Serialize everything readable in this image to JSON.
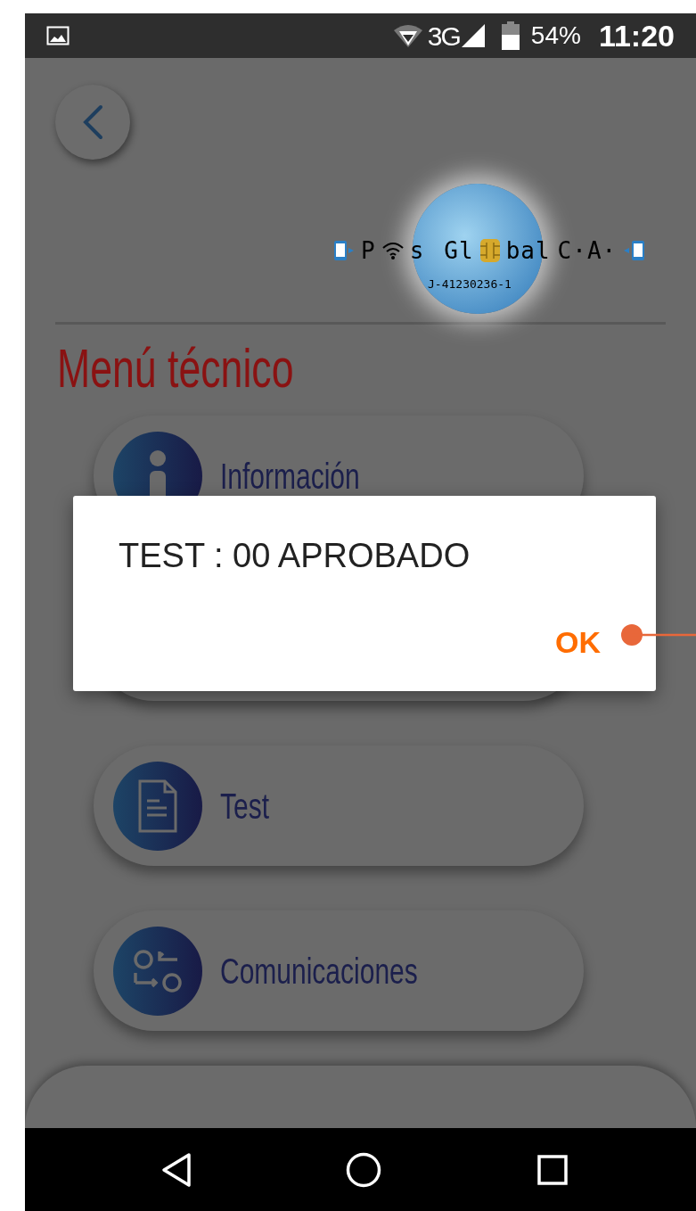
{
  "status_bar": {
    "network": "3G",
    "battery": "54%",
    "time": "11:20"
  },
  "logo": {
    "parts": [
      {
        "kind": "text",
        "text": "P"
      },
      {
        "kind": "wifi"
      },
      {
        "kind": "text",
        "text": "s"
      },
      {
        "kind": "gap"
      },
      {
        "kind": "text",
        "text": "Gl"
      },
      {
        "kind": "chip"
      },
      {
        "kind": "text",
        "text": "bal"
      },
      {
        "kind": "text",
        "text": "C·A·"
      }
    ],
    "rif": "J-41230236-1"
  },
  "title": "Menú técnico",
  "menu": [
    {
      "kind": "info",
      "label": "Información"
    },
    {
      "kind": "blank"
    },
    {
      "kind": "document",
      "label": "Test"
    },
    {
      "kind": "swap",
      "label": "Comunicaciones"
    }
  ],
  "dialog": {
    "message": "TEST : 00 APROBADO",
    "button": "OK"
  }
}
